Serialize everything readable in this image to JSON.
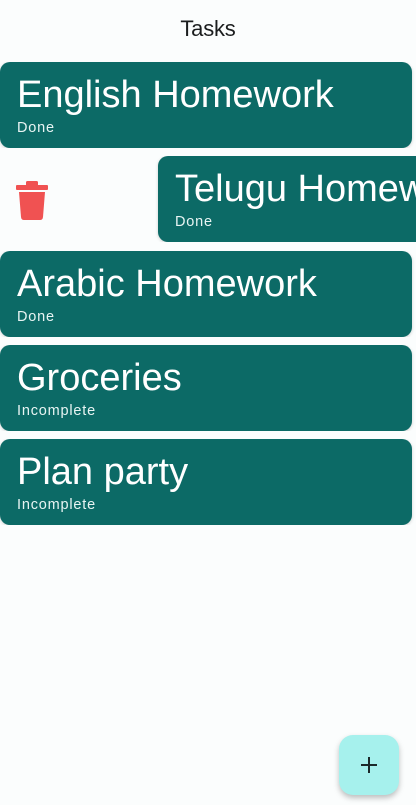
{
  "app_bar": {
    "title": "Tasks"
  },
  "tasks": [
    {
      "title": "English Homework",
      "status": "Done"
    },
    {
      "title": "Telugu Homework",
      "status": "Done"
    },
    {
      "title": "Arabic Homework",
      "status": "Done"
    },
    {
      "title": "Groceries",
      "status": "Incomplete"
    },
    {
      "title": "Plan party",
      "status": "Incomplete"
    }
  ],
  "colors": {
    "card": "#0c6a66",
    "delete": "#f05252",
    "fab": "#a6f1ed"
  },
  "icons": {
    "delete": "trash-icon",
    "fab": "plus-icon"
  }
}
